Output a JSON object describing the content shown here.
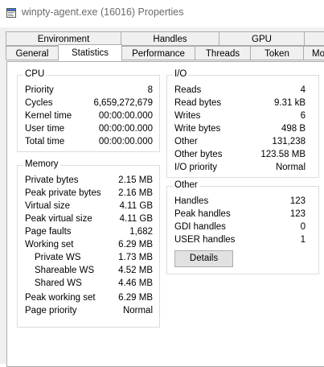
{
  "window": {
    "title": "winpty-agent.exe (16016) Properties"
  },
  "tabs": {
    "row1": [
      "Environment",
      "Handles",
      "GPU"
    ],
    "row2": [
      "General",
      "Statistics",
      "Performance",
      "Threads",
      "Token",
      "Mo"
    ]
  },
  "cpu": {
    "title": "CPU",
    "rows": [
      {
        "label": "Priority",
        "value": "8"
      },
      {
        "label": "Cycles",
        "value": "6,659,272,679"
      },
      {
        "label": "Kernel time",
        "value": "00:00:00.000"
      },
      {
        "label": "User time",
        "value": "00:00:00.000"
      },
      {
        "label": "Total time",
        "value": "00:00:00.000"
      }
    ]
  },
  "memory": {
    "title": "Memory",
    "rows": [
      {
        "label": "Private bytes",
        "value": "2.15 MB"
      },
      {
        "label": "Peak private bytes",
        "value": "2.16 MB"
      },
      {
        "label": "Virtual size",
        "value": "4.11 GB"
      },
      {
        "label": "Peak virtual size",
        "value": "4.11 GB"
      },
      {
        "label": "Page faults",
        "value": "1,682"
      },
      {
        "label": "Working set",
        "value": "6.29 MB"
      },
      {
        "label": "Private WS",
        "value": "1.73 MB"
      },
      {
        "label": "Shareable WS",
        "value": "4.52 MB"
      },
      {
        "label": "Shared WS",
        "value": "4.46 MB"
      },
      {
        "label": "Peak working set",
        "value": "6.29 MB"
      },
      {
        "label": "Page priority",
        "value": "Normal"
      }
    ]
  },
  "io": {
    "title": "I/O",
    "rows": [
      {
        "label": "Reads",
        "value": "4"
      },
      {
        "label": "Read bytes",
        "value": "9.31 kB"
      },
      {
        "label": "Writes",
        "value": "6"
      },
      {
        "label": "Write bytes",
        "value": "498 B"
      },
      {
        "label": "Other",
        "value": "131,238"
      },
      {
        "label": "Other bytes",
        "value": "123.58 MB"
      },
      {
        "label": "I/O priority",
        "value": "Normal"
      }
    ]
  },
  "other": {
    "title": "Other",
    "rows": [
      {
        "label": "Handles",
        "value": "123"
      },
      {
        "label": "Peak handles",
        "value": "123"
      },
      {
        "label": "GDI handles",
        "value": "0"
      },
      {
        "label": "USER handles",
        "value": "1"
      }
    ],
    "details_button": "Details"
  }
}
